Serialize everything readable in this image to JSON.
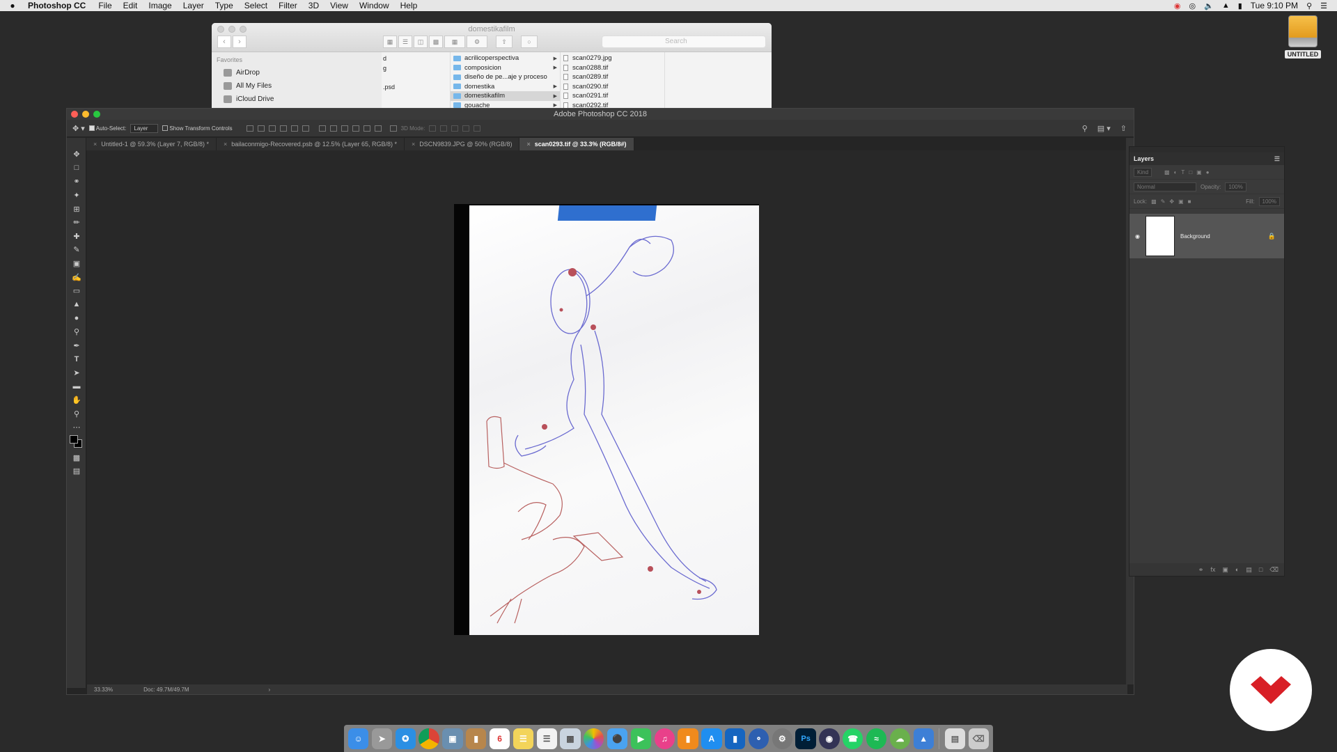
{
  "menubar": {
    "app_name": "Photoshop CC",
    "menus": [
      "File",
      "Edit",
      "Image",
      "Layer",
      "Type",
      "Select",
      "Filter",
      "3D",
      "View",
      "Window",
      "Help"
    ],
    "clock": "Tue 9:10 PM"
  },
  "desktop": {
    "drive_label": "UNTITLED"
  },
  "finder": {
    "title": "domestikafilm",
    "search_placeholder": "Search",
    "sidebar_heading": "Favorites",
    "sidebar_items": [
      "AirDrop",
      "All My Files",
      "iCloud Drive"
    ],
    "col1": [
      "d",
      "g",
      "",
      ".psd"
    ],
    "folders": [
      "acrilicoperspectiva",
      "composicion",
      "diseño de pe...aje y proceso",
      "domestika",
      "domestikafilm",
      "gouache"
    ],
    "selected_folder": "domestikafilm",
    "files": [
      "scan0279.jpg",
      "scan0288.tif",
      "scan0289.tif",
      "scan0290.tif",
      "scan0291.tif",
      "scan0292.tif"
    ]
  },
  "photoshop": {
    "window_title": "Adobe Photoshop CC 2018",
    "options": {
      "auto_select_label": "Auto-Select:",
      "auto_select_value": "Layer",
      "transform_label": "Show Transform Controls",
      "mode_3d": "3D Mode:"
    },
    "tabs": [
      "Untitled-1 @ 59.3% (Layer 7, RGB/8) *",
      "bailaconmigo-Recovered.psb @ 12.5% (Layer 65, RGB/8) *",
      "DSCN9839.JPG @ 50% (RGB/8)",
      "scan0293.tif @ 33.3% (RGB/8#)"
    ],
    "active_tab": 3,
    "status": {
      "zoom": "33.33%",
      "doc": "Doc: 49.7M/49.7M"
    },
    "layers_panel": {
      "title": "Layers",
      "filter_placeholder": "Kind",
      "blend_mode": "Normal",
      "opacity_label": "Opacity:",
      "opacity_value": "100%",
      "lock_label": "Lock:",
      "fill_label": "Fill:",
      "fill_value": "100%",
      "layer_name": "Background"
    }
  },
  "colors": {
    "accent_red": "#d81f26",
    "tape_blue": "#2f6fcf"
  }
}
